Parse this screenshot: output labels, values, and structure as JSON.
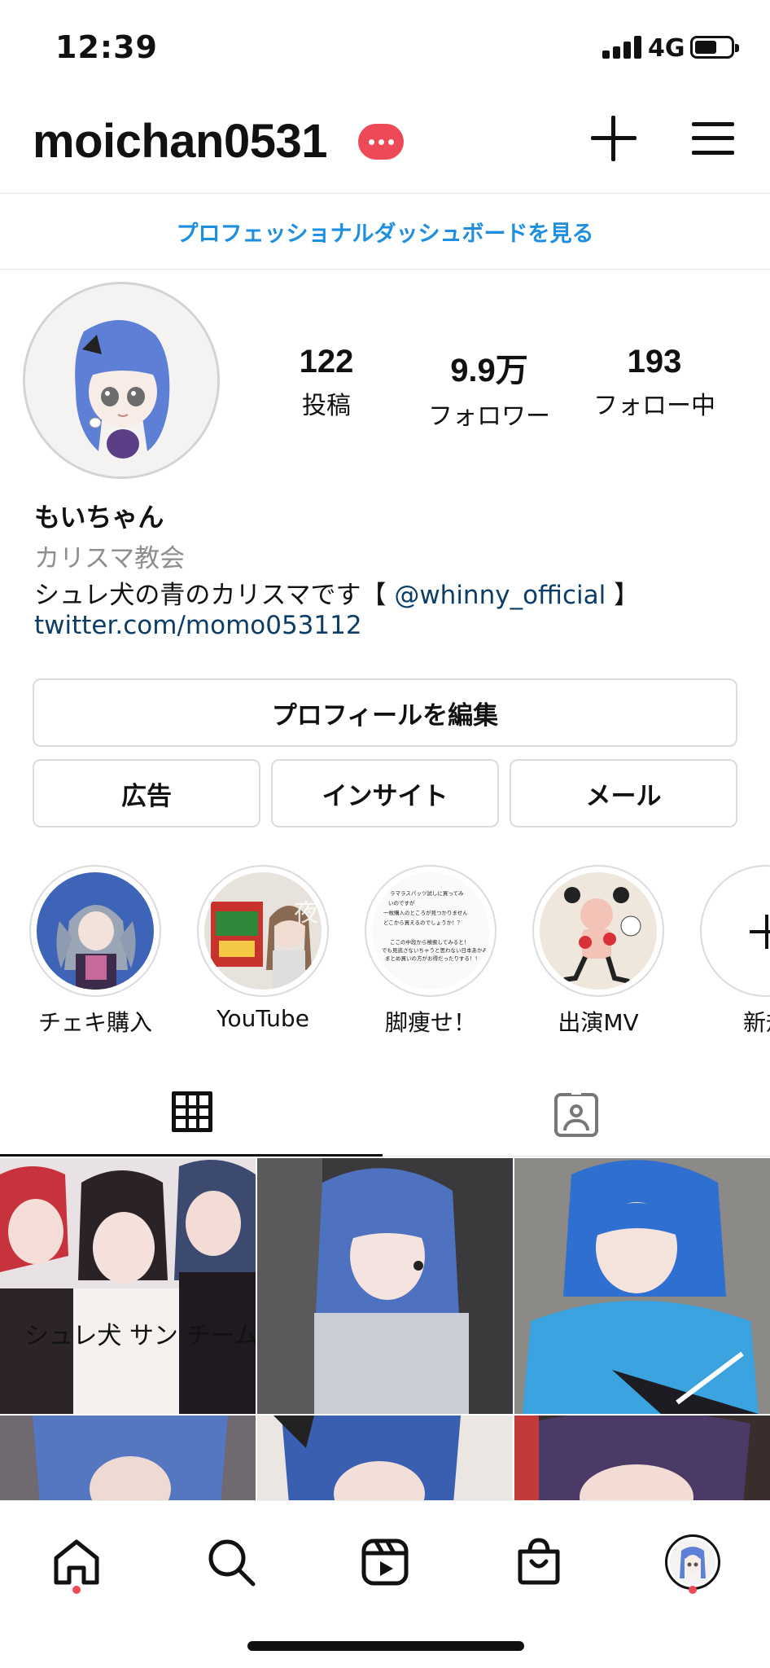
{
  "status_bar": {
    "time": "12:39",
    "network": "4G"
  },
  "header": {
    "username": "moichan0531"
  },
  "dashboard_link": "プロフェッショナルダッシュボードを見る",
  "profile": {
    "stats": [
      {
        "value": "122",
        "label": "投稿"
      },
      {
        "value": "9.9万",
        "label": "フォロワー"
      },
      {
        "value": "193",
        "label": "フォロー中"
      }
    ],
    "name": "もいちゃん",
    "category": "カリスマ教会",
    "bio_prefix": "シュレ犬の青のカリスマです【 ",
    "bio_mention": "@whinny_official",
    "bio_suffix": " 】",
    "link": "twitter.com/momo053112"
  },
  "buttons": {
    "edit_profile": "プロフィールを編集",
    "ads": "広告",
    "insights": "インサイト",
    "mail": "メール"
  },
  "highlights": [
    {
      "label": "チェキ購入"
    },
    {
      "label": "YouTube"
    },
    {
      "label": "脚痩せ！"
    },
    {
      "label": "出演MV"
    },
    {
      "label": "新規"
    }
  ],
  "highlight_thumb_text": {
    "youtube_overlay": "夜食",
    "note_lines": [
      "ラマラスパッツ試しに買ってみ",
      "いのですが",
      "一枚購入のところが見つかりません",
      "どこから買えるのでしょうか！？",
      "ここの中段から検索してみると！",
      "でも見逃さないちゃうと思わない日本あかみ",
      "まとめ買いの方がお得だったりする！！"
    ]
  },
  "post_overlay_text": "シュレ犬 サン チーム",
  "colors": {
    "accent": "#1e8fde",
    "badge": "#ed4956",
    "link": "#0b3d67"
  },
  "icons": [
    "plus-icon",
    "menu-icon",
    "grid-icon",
    "tagged-icon",
    "home-icon",
    "search-icon",
    "reels-icon",
    "shop-icon"
  ]
}
